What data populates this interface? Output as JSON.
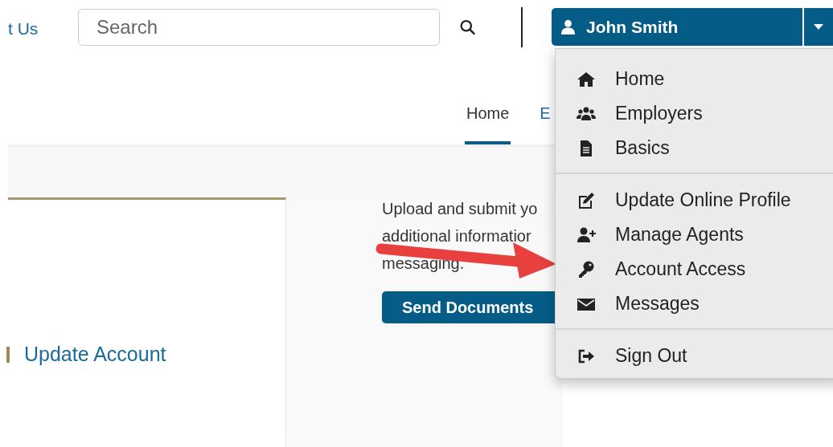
{
  "header": {
    "link": "t Us",
    "search": {
      "placeholder": "Search"
    },
    "user": {
      "name": "John Smith"
    }
  },
  "menu": {
    "sections": [
      [
        {
          "label": "Home",
          "kind": "home"
        },
        {
          "label": "Employers",
          "kind": "users"
        },
        {
          "label": "Basics",
          "kind": "file"
        }
      ],
      [
        {
          "label": "Update Online Profile",
          "kind": "edit"
        },
        {
          "label": "Manage Agents",
          "kind": "user-plus"
        },
        {
          "label": "Account Access",
          "kind": "key"
        },
        {
          "label": "Messages",
          "kind": "envelope"
        }
      ],
      [
        {
          "label": "Sign Out",
          "kind": "sign-out"
        }
      ]
    ]
  },
  "tabs": [
    {
      "label": "Home",
      "selected": true
    },
    {
      "label": "E",
      "selected": false
    }
  ],
  "card": {
    "link": "Update Account"
  },
  "documents": {
    "lines": [
      "Upload and submit yo",
      "additional informatior",
      "messaging."
    ],
    "button": "Send Documents"
  }
}
